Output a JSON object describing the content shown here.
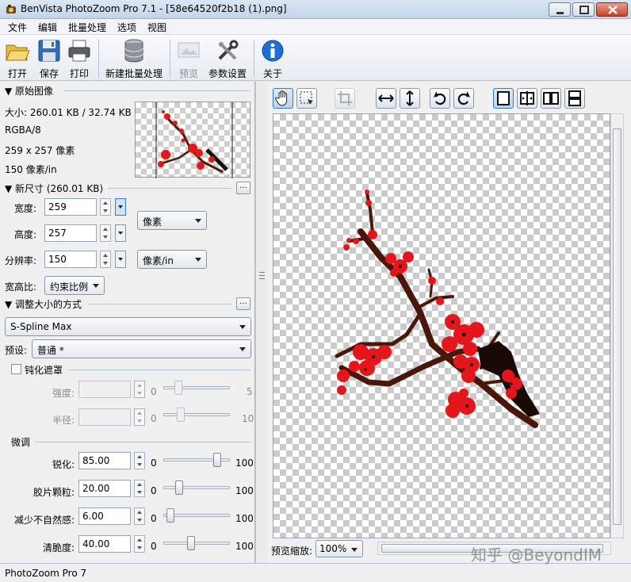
{
  "window": {
    "title": "BenVista PhotoZoom Pro 7.1 - [58e64520f2b18 (1).png]"
  },
  "menu": [
    "文件",
    "编辑",
    "批量处理",
    "选项",
    "视图"
  ],
  "toolbar": {
    "open": "打开",
    "save": "保存",
    "print": "打印",
    "new_batch": "新建批量处理",
    "preview": "预览",
    "settings": "参数设置",
    "about": "关于"
  },
  "original": {
    "section_title": "▼ 原始图像",
    "size": "大小: 260.01 KB / 32.74 KB",
    "mode": "RGBA/8",
    "dimensions": "259 x 257 像素",
    "resolution": "150 像素/in"
  },
  "new_size": {
    "section_title": "▼ 新尺寸 (260.01 KB)",
    "width_label": "宽度:",
    "width_value": "259",
    "height_label": "高度:",
    "height_value": "257",
    "unit": "像素",
    "resolution_label": "分辨率:",
    "resolution_value": "150",
    "resolution_unit": "像素/in",
    "aspect_label": "宽高比:",
    "aspect_value": "约束比例"
  },
  "resize_method": {
    "section_title": "▼ 调整大小的方式",
    "method": "S-Spline Max",
    "preset_label": "预设:",
    "preset_value": "普通 *"
  },
  "unsharp": {
    "section_title": "钝化遮罩",
    "checked": false,
    "strength_label": "强度:",
    "strength_min": "0",
    "strength_max": "5",
    "radius_label": "半径:",
    "radius_min": "0",
    "radius_max": "10"
  },
  "finetune": {
    "section_title": "微调",
    "rows": [
      {
        "label": "锐化:",
        "value": "85.00",
        "min": "0",
        "max": "100",
        "level": 0.85
      },
      {
        "label": "胶片颗粒:",
        "value": "20.00",
        "min": "0",
        "max": "100",
        "level": 0.2
      },
      {
        "label": "减少不自然感:",
        "value": "6.00",
        "min": "0",
        "max": "100",
        "level": 0.06
      },
      {
        "label": "清脆度:",
        "value": "40.00",
        "min": "0",
        "max": "100",
        "level": 0.4
      }
    ]
  },
  "preview": {
    "zoom_label": "预览缩放:",
    "zoom_value": "100%"
  },
  "status": "PhotoZoom Pro 7",
  "watermark": "知乎 @BeyondIM"
}
